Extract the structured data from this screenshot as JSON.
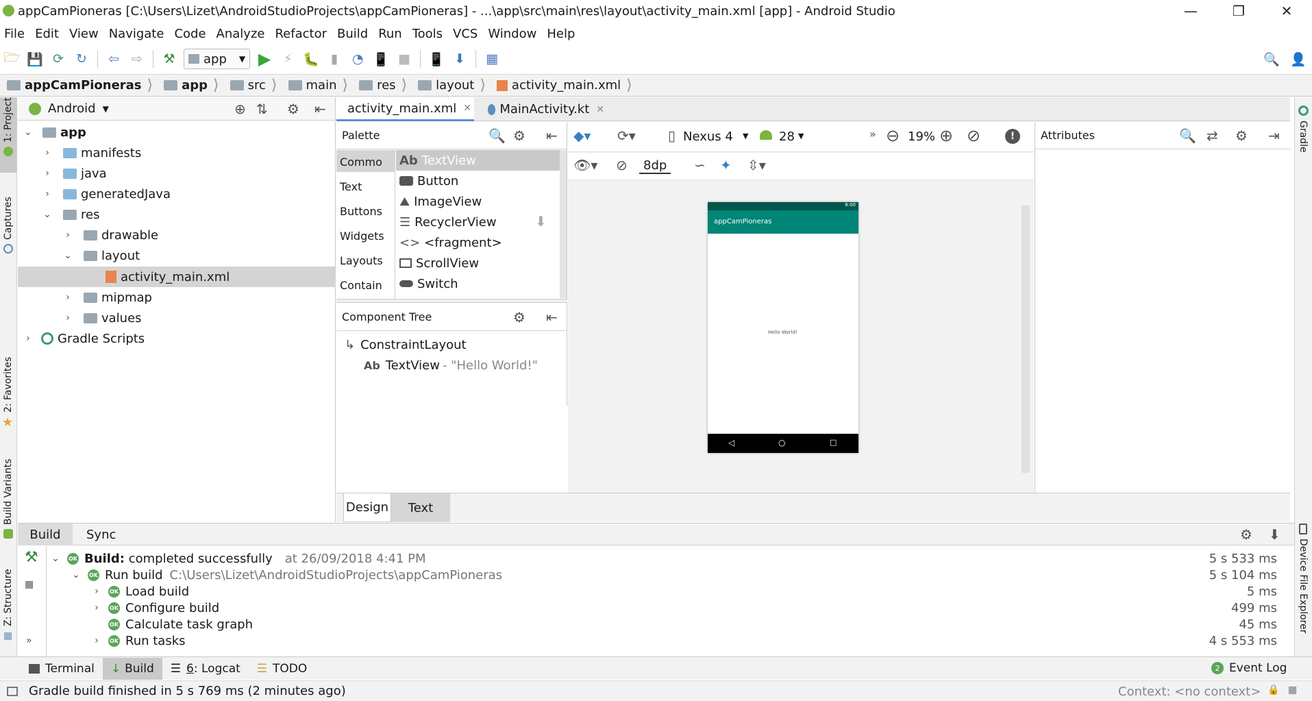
{
  "window": {
    "title": "appCamPioneras [C:\\Users\\Lizet\\AndroidStudioProjects\\appCamPioneras] - ...\\app\\src\\main\\res\\layout\\activity_main.xml [app] - Android Studio"
  },
  "menu": [
    "File",
    "Edit",
    "View",
    "Navigate",
    "Code",
    "Analyze",
    "Refactor",
    "Build",
    "Run",
    "Tools",
    "VCS",
    "Window",
    "Help"
  ],
  "toolbar": {
    "run_config": "app"
  },
  "breadcrumb": [
    "appCamPioneras",
    "app",
    "src",
    "main",
    "res",
    "layout",
    "activity_main.xml"
  ],
  "left_strip": {
    "project": "1: Project",
    "captures": "Captures",
    "favorites": "2: Favorites",
    "build_variants": "Build Variants",
    "structure": "Z: Structure"
  },
  "right_strip": {
    "gradle": "Gradle",
    "device_explorer": "Device File Explorer"
  },
  "project_panel": {
    "view": "Android",
    "tree": [
      {
        "label": "app",
        "level": 0,
        "expanded": true,
        "bold": true
      },
      {
        "label": "manifests",
        "level": 1
      },
      {
        "label": "java",
        "level": 1
      },
      {
        "label": "generatedJava",
        "level": 1
      },
      {
        "label": "res",
        "level": 1,
        "expanded": true
      },
      {
        "label": "drawable",
        "level": 2
      },
      {
        "label": "layout",
        "level": 2,
        "expanded": true
      },
      {
        "label": "activity_main.xml",
        "level": 3,
        "selected": true
      },
      {
        "label": "mipmap",
        "level": 2
      },
      {
        "label": "values",
        "level": 2
      },
      {
        "label": "Gradle Scripts",
        "level": 0
      }
    ]
  },
  "editor_tabs": [
    {
      "label": "activity_main.xml",
      "active": true
    },
    {
      "label": "MainActivity.kt",
      "active": false
    }
  ],
  "palette": {
    "title": "Palette",
    "categories": [
      "Commo",
      "Text",
      "Buttons",
      "Widgets",
      "Layouts",
      "Contain"
    ],
    "items": [
      {
        "prefix": "Ab",
        "label": "TextView"
      },
      {
        "label": "Button"
      },
      {
        "label": "ImageView"
      },
      {
        "label": "RecyclerView"
      },
      {
        "label": "<fragment>"
      },
      {
        "label": "ScrollView"
      },
      {
        "label": "Switch"
      }
    ]
  },
  "component_tree": {
    "title": "Component Tree",
    "root": "ConstraintLayout",
    "child_prefix": "Ab",
    "child": "TextView",
    "child_detail": "- \"Hello World!\""
  },
  "design_toolbar": {
    "device": "Nexus 4",
    "api": "28",
    "zoom": "19%",
    "margin": "8dp"
  },
  "phone_preview": {
    "app_name": "appCamPioneras",
    "status_time": "8:00",
    "text": "Hello World!",
    "colors": {
      "status": "#00574b",
      "toolbar": "#008577",
      "navbar": "#000000"
    }
  },
  "attributes": {
    "title": "Attributes"
  },
  "design_tabs": {
    "design": "Design",
    "text": "Text"
  },
  "build": {
    "tabs": [
      "Build",
      "Sync"
    ],
    "rows": [
      {
        "bold": "Build:",
        "text": "completed successfully",
        "extra": "at 26/09/2018 4:41 PM",
        "time": "5 s 533 ms"
      },
      {
        "text": "Run build",
        "extra": "C:\\Users\\Lizet\\AndroidStudioProjects\\appCamPioneras",
        "time": "5 s 104 ms"
      },
      {
        "text": "Load build",
        "time": "5 ms"
      },
      {
        "text": "Configure build",
        "time": "499 ms"
      },
      {
        "text": "Calculate task graph",
        "time": "45 ms"
      },
      {
        "text": "Run tasks",
        "time": "4 s 553 ms"
      }
    ],
    "ok_badge": "OK"
  },
  "tool_windows": {
    "terminal": "Terminal",
    "build": "Build",
    "logcat_num": "6",
    "logcat": ": Logcat",
    "todo": "TODO",
    "event_log_count": "2",
    "event_log": "Event Log"
  },
  "status": {
    "message": "Gradle build finished in 5 s 769 ms (2 minutes ago)",
    "context": "Context: <no context>"
  }
}
